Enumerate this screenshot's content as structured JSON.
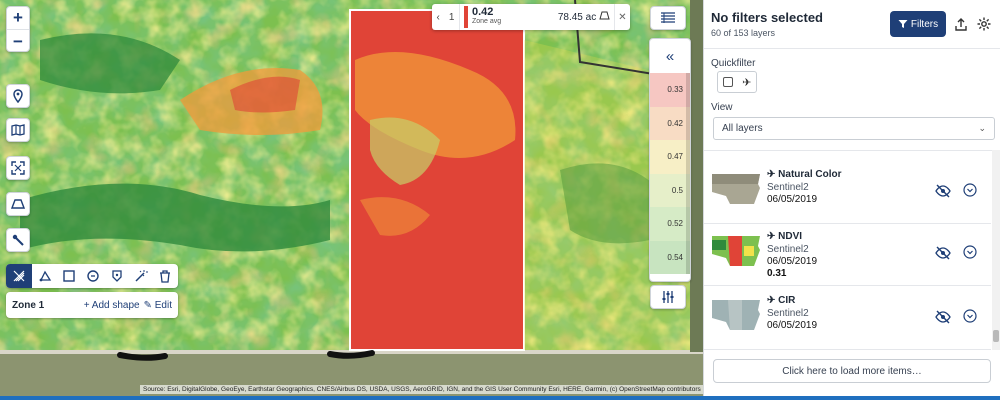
{
  "map": {
    "zoom_in": "+",
    "zoom_out": "−",
    "tools": [
      "location-pin-icon",
      "map-book-icon",
      "fit-extent-icon",
      "perspective-icon",
      "draw-pointer-icon"
    ],
    "attribution": "Source: Esri, DigitalGlobe, GeoEye, Earthstar Geographics, CNES/Airbus DS, USDA, USGS, AeroGRID, IGN, and the GIS User Community Esri, HERE, Garmin, (c) OpenStreetMap contributors"
  },
  "zone_info": {
    "index": "1",
    "value": "0.42",
    "label": "Zone avg",
    "area": "78.45 ac",
    "color": "#e04437"
  },
  "zone_card": {
    "name": "Zone 1",
    "add_shape": "+ Add shape",
    "edit": "Edit"
  },
  "legend": {
    "collapse": "«",
    "rows": [
      {
        "value": "0.33",
        "color": "#f6c7c2"
      },
      {
        "value": "0.42",
        "color": "#f8dcc4"
      },
      {
        "value": "0.47",
        "color": "#f7efc6"
      },
      {
        "value": "0.5",
        "color": "#e6efc9"
      },
      {
        "value": "0.52",
        "color": "#d6ebc6"
      },
      {
        "value": "0.54",
        "color": "#c8e4c0"
      }
    ]
  },
  "panel": {
    "title": "No filters selected",
    "subtitle": "60 of 153 layers",
    "filters_button": "Filters",
    "quickfilter_label": "Quickfilter",
    "view_label": "View",
    "view_value": "All layers",
    "load_more": "Click here to load more items…",
    "layers": [
      {
        "name": "Natural Color",
        "source": "Sentinel2",
        "date": "06/05/2019",
        "value": ""
      },
      {
        "name": "NDVI",
        "source": "Sentinel2",
        "date": "06/05/2019",
        "value": "0.31"
      },
      {
        "name": "CIR",
        "source": "Sentinel2",
        "date": "06/05/2019",
        "value": ""
      }
    ]
  },
  "colors": {
    "accent": "#1f3f77",
    "ndvi_high": "#2f8a3c",
    "ndvi_mid": "#f2e24a",
    "ndvi_low": "#e04437"
  }
}
